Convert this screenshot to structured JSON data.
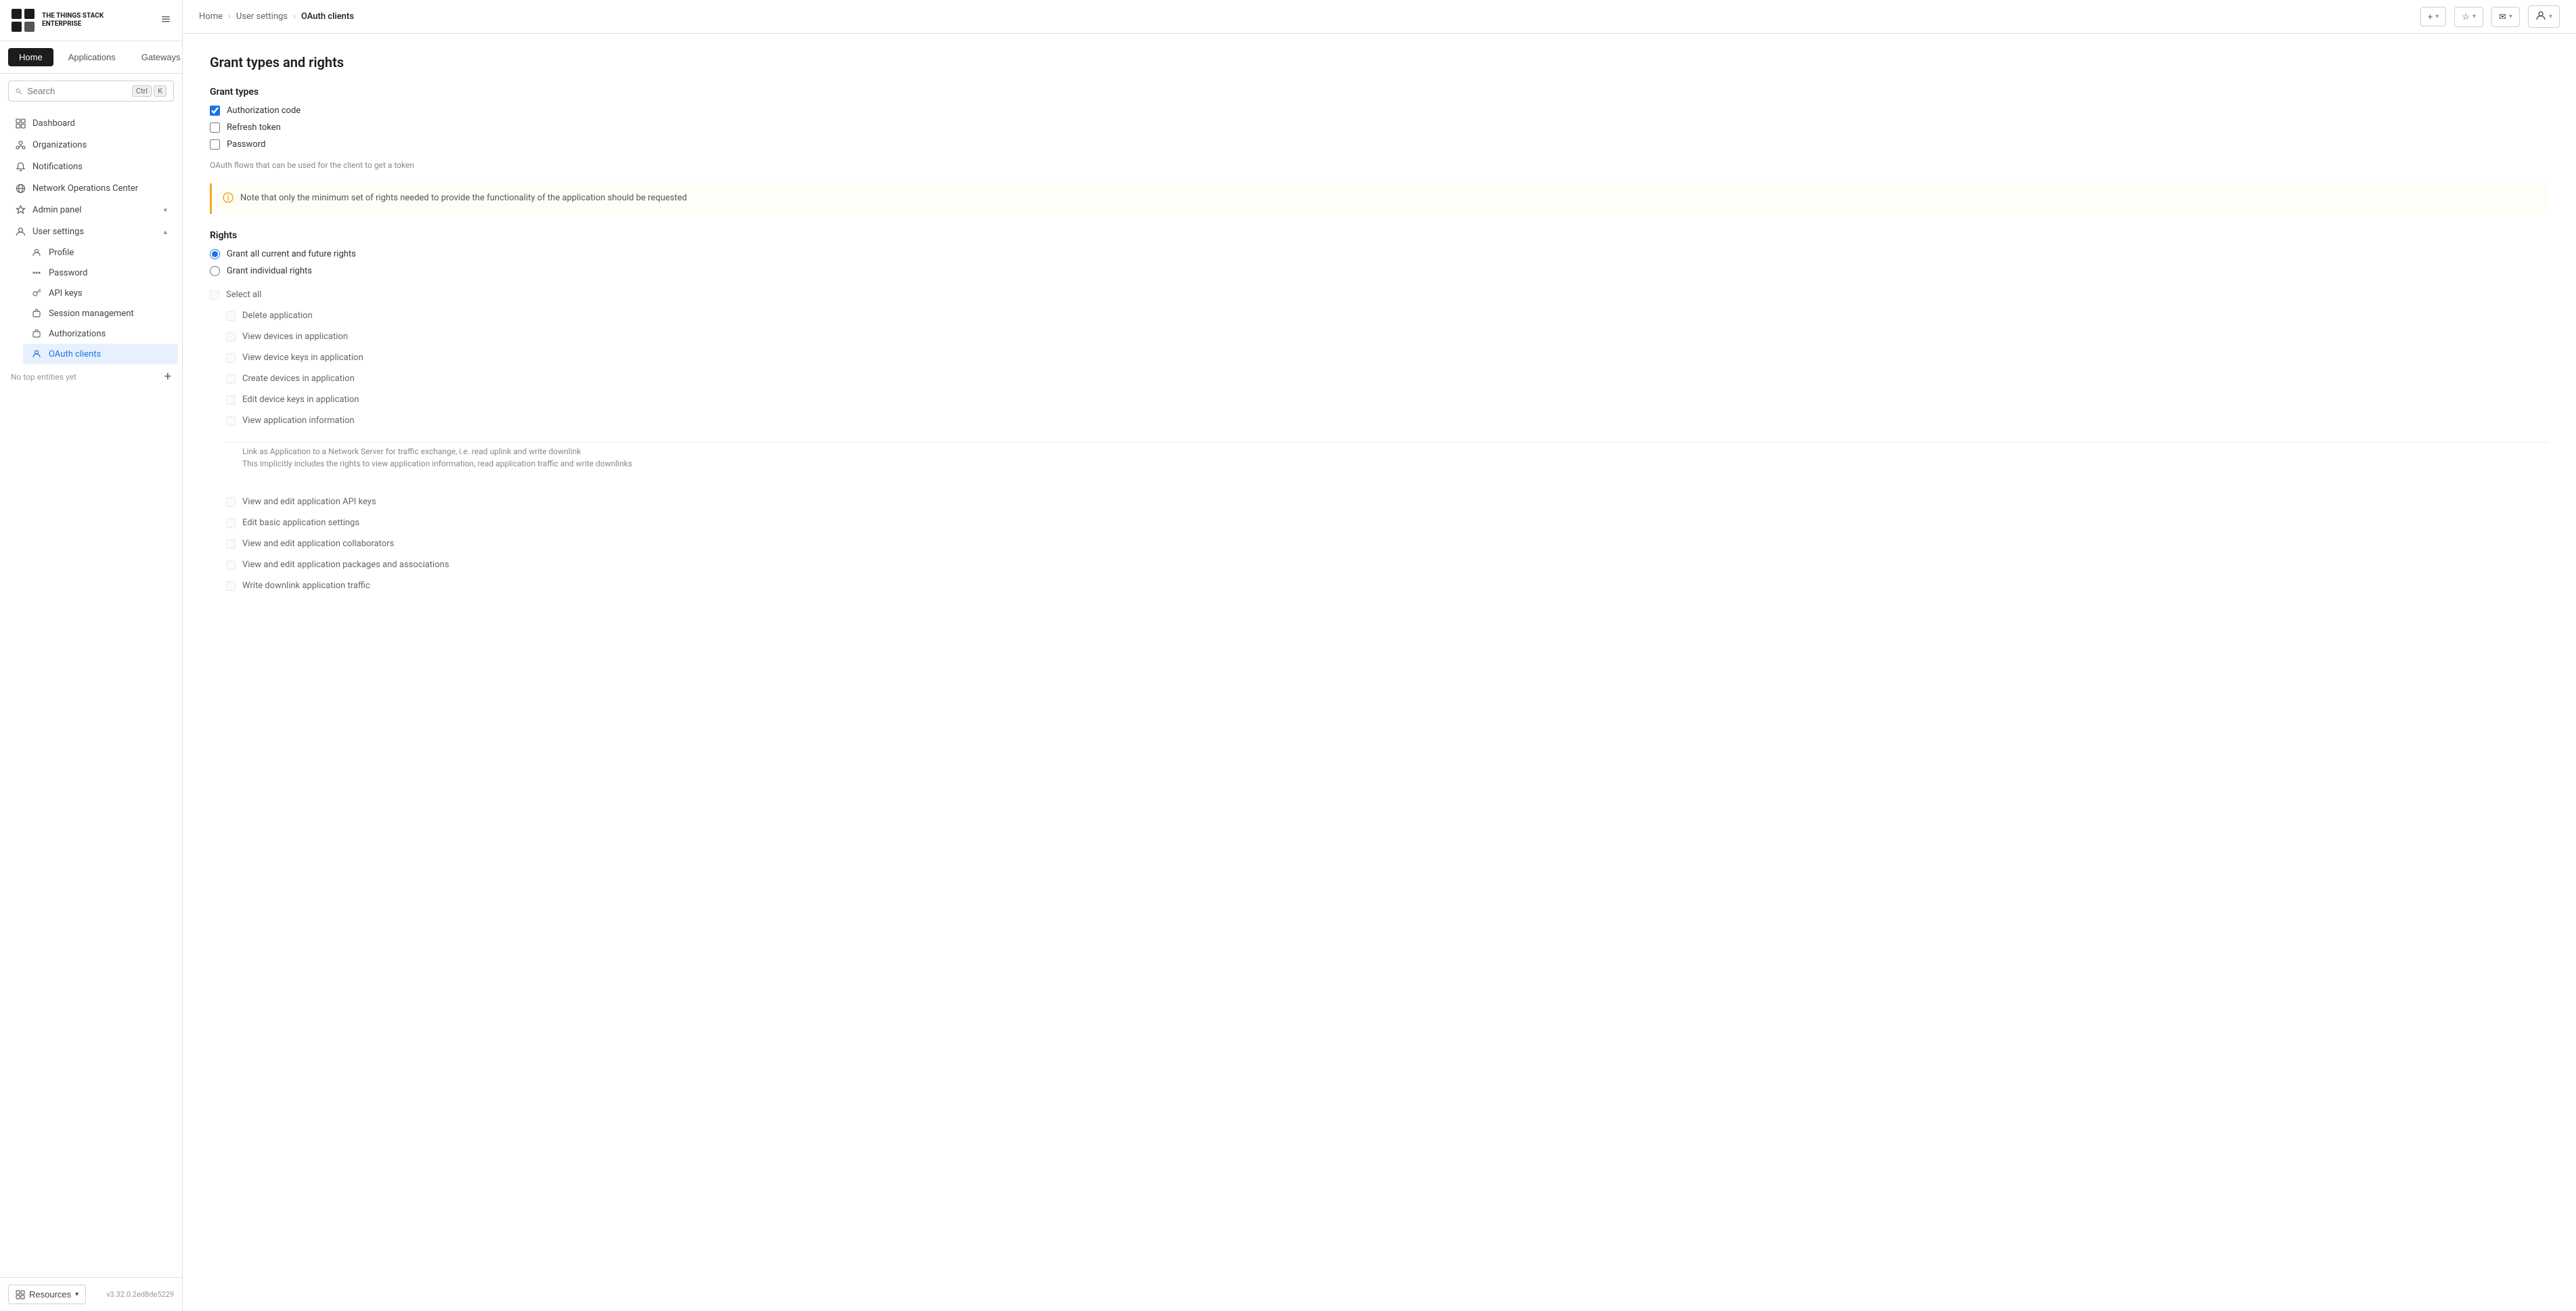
{
  "app": {
    "title": "THE THINGS STACK",
    "subtitle": "ENTERPRISE",
    "version": "v3.32.0.2ed8de5229"
  },
  "topnav": {
    "home": "Home",
    "applications": "Applications",
    "gateways": "Gateways"
  },
  "search": {
    "placeholder": "Search",
    "key1": "Ctrl",
    "key2": "K"
  },
  "sidebar": {
    "items": [
      {
        "id": "dashboard",
        "label": "Dashboard",
        "icon": "⊞"
      },
      {
        "id": "organizations",
        "label": "Organizations",
        "icon": "🏢"
      },
      {
        "id": "notifications",
        "label": "Notifications",
        "icon": "🔔"
      },
      {
        "id": "network-ops",
        "label": "Network Operations Center",
        "icon": "📡"
      },
      {
        "id": "admin-panel",
        "label": "Admin panel",
        "icon": "🛡",
        "hasChevron": true
      },
      {
        "id": "user-settings",
        "label": "User settings",
        "icon": "👤",
        "hasChevron": true,
        "expanded": true
      }
    ],
    "userSettingsSubmenu": [
      {
        "id": "profile",
        "label": "Profile",
        "icon": "⚙"
      },
      {
        "id": "password",
        "label": "Password",
        "icon": "···"
      },
      {
        "id": "api-keys",
        "label": "API keys",
        "icon": "🔑"
      },
      {
        "id": "session-management",
        "label": "Session management",
        "icon": "🔒"
      },
      {
        "id": "authorizations",
        "label": "Authorizations",
        "icon": "🔒"
      },
      {
        "id": "oauth-clients",
        "label": "OAuth clients",
        "icon": "👤",
        "active": true
      }
    ],
    "noTopEntities": "No top entities yet"
  },
  "breadcrumb": {
    "home": "Home",
    "userSettings": "User settings",
    "current": "OAuth clients"
  },
  "topbarActions": {
    "add": "+",
    "star": "★",
    "mail": "✉",
    "user": "👤"
  },
  "page": {
    "title": "Grant types and rights",
    "grantTypesLabel": "Grant types",
    "checkboxes": [
      {
        "id": "authorization_code",
        "label": "Authorization code",
        "checked": true
      },
      {
        "id": "refresh_token",
        "label": "Refresh token",
        "checked": false
      },
      {
        "id": "password",
        "label": "Password",
        "checked": false
      }
    ],
    "grantTypesHelper": "OAuth flows that can be used for the client to get a token",
    "infoBanner": "Note that only the minimum set of rights needed to provide the functionality of the application should be requested",
    "rightsLabel": "Rights",
    "radioOptions": [
      {
        "id": "grant_all",
        "label": "Grant all current and future rights",
        "checked": true
      },
      {
        "id": "grant_individual",
        "label": "Grant individual rights",
        "checked": false
      }
    ],
    "individualRights": [
      {
        "id": "select_all",
        "label": "Select all",
        "checked": false,
        "indent": 0
      },
      {
        "id": "delete_application",
        "label": "Delete application",
        "checked": false,
        "indent": 1
      },
      {
        "id": "view_devices",
        "label": "View devices in application",
        "checked": false,
        "indent": 1
      },
      {
        "id": "view_device_keys",
        "label": "View device keys in application",
        "checked": false,
        "indent": 1
      },
      {
        "id": "create_devices",
        "label": "Create devices in application",
        "checked": false,
        "indent": 1
      },
      {
        "id": "edit_device_keys",
        "label": "Edit device keys in application",
        "checked": false,
        "indent": 1
      },
      {
        "id": "view_application_info",
        "label": "View application information",
        "checked": false,
        "indent": 1
      }
    ],
    "networkServerGroup": {
      "description": "Link as Application to a Network Server for traffic exchange, i.e. read uplink and write downlink",
      "subDescription": "This implicitly includes the rights to view application information, read application traffic and write downlinks"
    },
    "moreRights": [
      {
        "id": "view_edit_api_keys",
        "label": "View and edit application API keys",
        "checked": false
      },
      {
        "id": "edit_basic_settings",
        "label": "Edit basic application settings",
        "checked": false
      },
      {
        "id": "view_edit_collaborators",
        "label": "View and edit application collaborators",
        "checked": false
      },
      {
        "id": "view_edit_packages",
        "label": "View and edit application packages and associations",
        "checked": false
      },
      {
        "id": "write_downlink",
        "label": "Write downlink application traffic",
        "checked": false
      }
    ]
  },
  "footer": {
    "resources": "Resources"
  }
}
